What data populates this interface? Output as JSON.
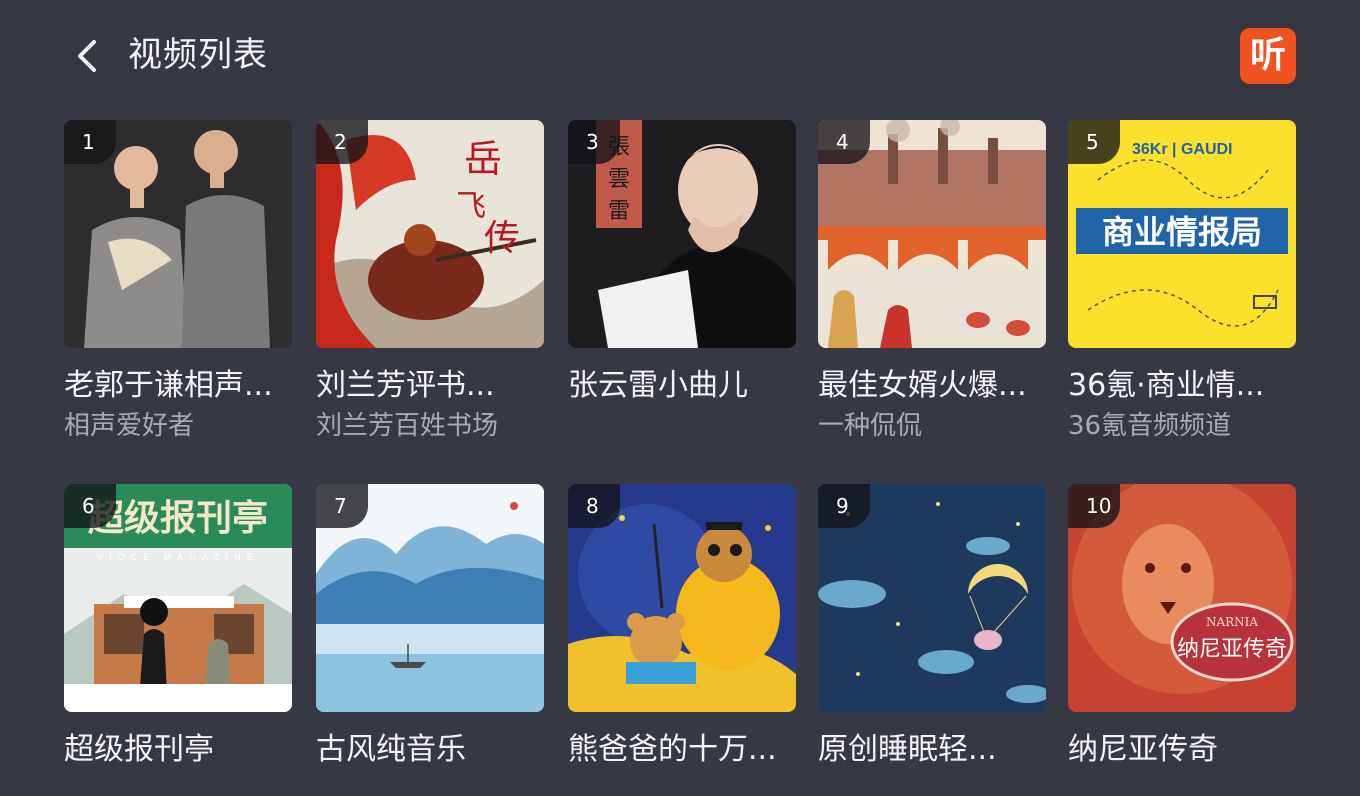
{
  "header": {
    "title": "视频列表",
    "logo_text": "听",
    "logo_color": "#f1521f"
  },
  "items": [
    {
      "rank": "1",
      "title": "老郭于谦相声...",
      "subtitle": "相声爱好者"
    },
    {
      "rank": "2",
      "title": "刘兰芳评书...",
      "subtitle": "刘兰芳百姓书场",
      "cover_text": "岳飞传"
    },
    {
      "rank": "3",
      "title": "张云雷小曲儿",
      "subtitle": "",
      "cover_text": "張雲雷"
    },
    {
      "rank": "4",
      "title": "最佳女婿火爆...",
      "subtitle": "一种侃侃"
    },
    {
      "rank": "5",
      "title": "36氪·商业情...",
      "subtitle": "36氪音频频道",
      "cover_text": "商业情报局",
      "cover_brand": "36Kr | GAUDI"
    },
    {
      "rank": "6",
      "title": "超级报刊亭",
      "subtitle": "",
      "cover_text": "超级报刊亭",
      "cover_brand": "VIOCE MAGAZINE"
    },
    {
      "rank": "7",
      "title": "古风纯音乐",
      "subtitle": ""
    },
    {
      "rank": "8",
      "title": "熊爸爸的十万...",
      "subtitle": ""
    },
    {
      "rank": "9",
      "title": "原创睡眠轻...",
      "subtitle": ""
    },
    {
      "rank": "10",
      "title": "纳尼亚传奇",
      "subtitle": "",
      "cover_text": "纳尼亚传奇",
      "cover_brand": "NARNIA"
    }
  ]
}
